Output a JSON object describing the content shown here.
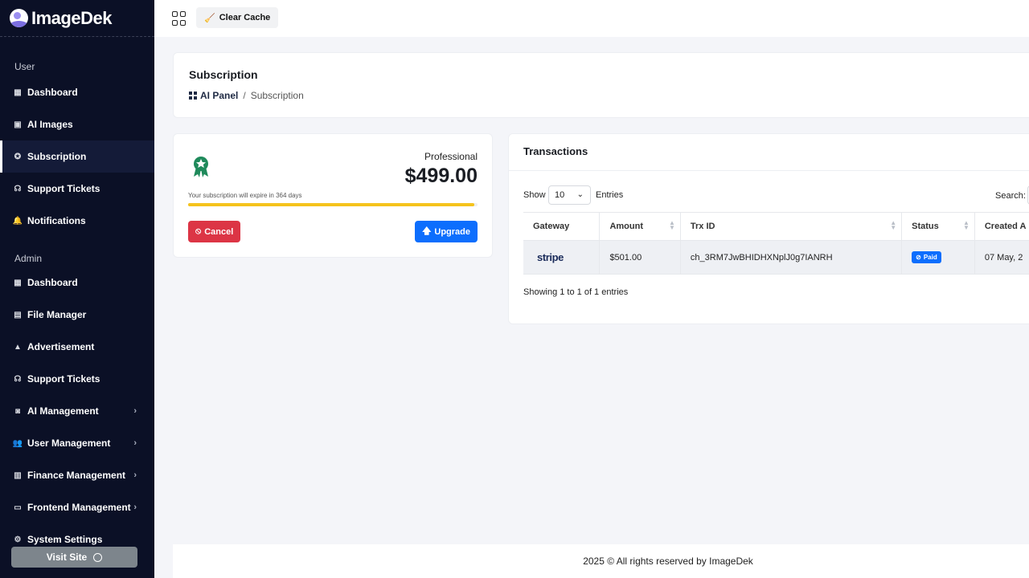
{
  "brand": {
    "name": "ImageDek"
  },
  "topbar": {
    "clear_cache_label": "Clear Cache"
  },
  "sidebar": {
    "user_section_label": "User",
    "user_items": [
      {
        "label": "Dashboard",
        "icon": "dashboard-icon"
      },
      {
        "label": "AI Images",
        "icon": "image-icon"
      },
      {
        "label": "Subscription",
        "icon": "award-icon",
        "active": true
      },
      {
        "label": "Support Tickets",
        "icon": "headset-icon"
      },
      {
        "label": "Notifications",
        "icon": "bell-icon"
      }
    ],
    "admin_section_label": "Admin",
    "admin_items": [
      {
        "label": "Dashboard",
        "icon": "dashboard-icon"
      },
      {
        "label": "File Manager",
        "icon": "folder-icon"
      },
      {
        "label": "Advertisement",
        "icon": "ad-icon"
      },
      {
        "label": "Support Tickets",
        "icon": "headset-icon"
      },
      {
        "label": "AI Management",
        "icon": "robot-icon",
        "expandable": true
      },
      {
        "label": "User Management",
        "icon": "users-icon",
        "expandable": true
      },
      {
        "label": "Finance Management",
        "icon": "bank-icon",
        "expandable": true
      },
      {
        "label": "Frontend Management",
        "icon": "monitor-icon",
        "expandable": true
      },
      {
        "label": "System Settings",
        "icon": "gear-icon"
      }
    ],
    "visit_site_label": "Visit Site"
  },
  "page": {
    "title": "Subscription",
    "breadcrumb": {
      "home": "AI Panel",
      "separator": "/",
      "current": "Subscription"
    }
  },
  "subscription": {
    "plan_name": "Professional",
    "price": "$499.00",
    "expire_text": "Your subscription will expire in 364 days",
    "progress_fraction": 0.99,
    "cancel_label": "Cancel",
    "upgrade_label": "Upgrade",
    "accent": "#f5c31c"
  },
  "transactions": {
    "title": "Transactions",
    "show_label": "Show",
    "entries_value": "10",
    "entries_label": "Entries",
    "search_label": "Search:",
    "columns": [
      "Gateway",
      "Amount",
      "Trx ID",
      "Status",
      "Created A"
    ],
    "rows": [
      {
        "gateway": "stripe",
        "amount": "$501.00",
        "trx_id": "ch_3RM7JwBHIDHXNplJ0g7IANRH",
        "status": "Paid",
        "created": "07 May, 2"
      }
    ],
    "showing_text": "Showing 1 to 1 of 1 entries"
  },
  "footer": {
    "text": "2025 © All rights reserved by ImageDek"
  }
}
